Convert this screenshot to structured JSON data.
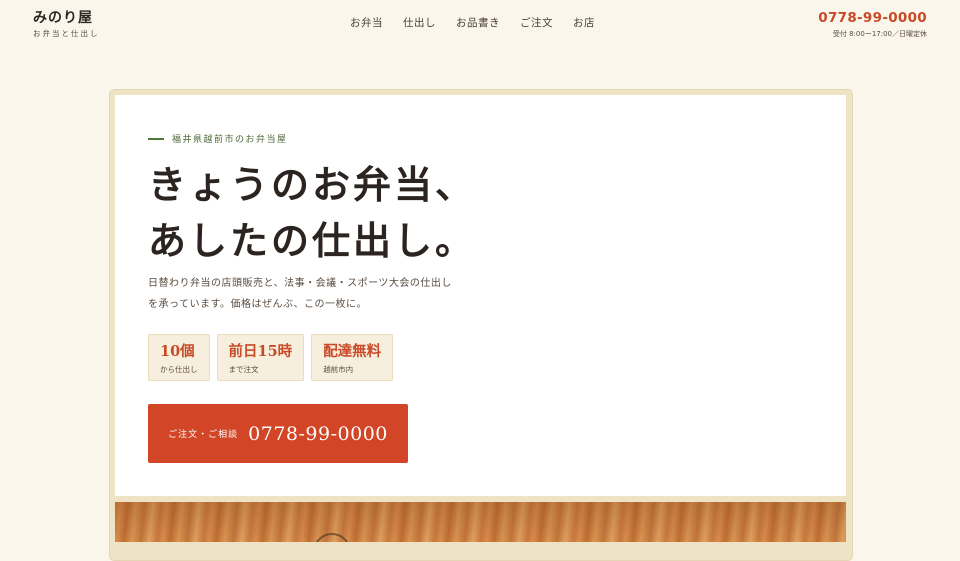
{
  "brand": {
    "name": "みのり屋",
    "sub": "お弁当と仕出し"
  },
  "nav": [
    {
      "label": "お弁当"
    },
    {
      "label": "仕出し"
    },
    {
      "label": "お品書き"
    },
    {
      "label": "ご注文"
    },
    {
      "label": "お店"
    }
  ],
  "contact": {
    "phone": "0778-99-0000",
    "hours": "受付 8:00ー17:00／日曜定休"
  },
  "hero": {
    "eyebrow": "福井県越前市のお弁当屋",
    "headline_line1": "きょうのお弁当、",
    "headline_line2": "あしたの仕出し。",
    "lead_line1": "日替わり弁当の店頭販売と、法事・会議・スポーツ大会の仕出し",
    "lead_line2": "を承っています。価格はぜんぶ、この一枚に。",
    "stats": [
      {
        "value": "10個",
        "note": "から仕出し"
      },
      {
        "value": "前日15時",
        "note": "まで注文"
      },
      {
        "value": "配達無料",
        "note": "越前市内"
      }
    ],
    "cta": {
      "label": "ご注文・ご相談",
      "phone": "0778-99-0000"
    }
  },
  "colors": {
    "background": "#fbf6ec",
    "accent": "#d24526",
    "eyebrow": "#4d7a3a"
  }
}
